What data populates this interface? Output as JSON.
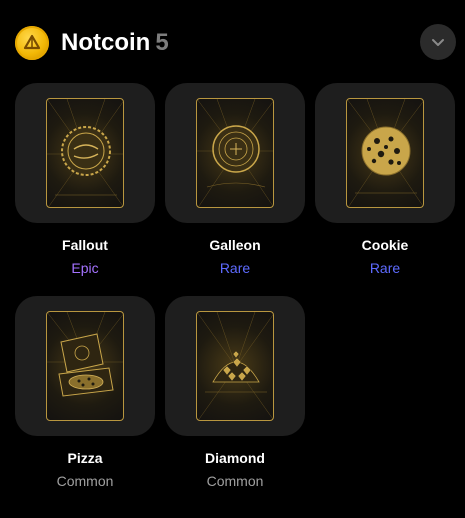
{
  "header": {
    "title": "Notcoin",
    "count": "5"
  },
  "colors": {
    "epic": "#a472ff",
    "rare": "#5e6bff",
    "common": "#a0a0a0",
    "gold": "#b8963f"
  },
  "items": [
    {
      "name": "Fallout",
      "rarity": "Epic",
      "rarity_color": "#a472ff",
      "art": "bottle-cap-icon"
    },
    {
      "name": "Galleon",
      "rarity": "Rare",
      "rarity_color": "#5e6bff",
      "art": "coin-seal-icon"
    },
    {
      "name": "Cookie",
      "rarity": "Rare",
      "rarity_color": "#5e6bff",
      "art": "cookie-icon"
    },
    {
      "name": "Pizza",
      "rarity": "Common",
      "rarity_color": "#a0a0a0",
      "art": "pizza-box-icon"
    },
    {
      "name": "Diamond",
      "rarity": "Common",
      "rarity_color": "#a0a0a0",
      "art": "diamond-pile-icon"
    }
  ]
}
